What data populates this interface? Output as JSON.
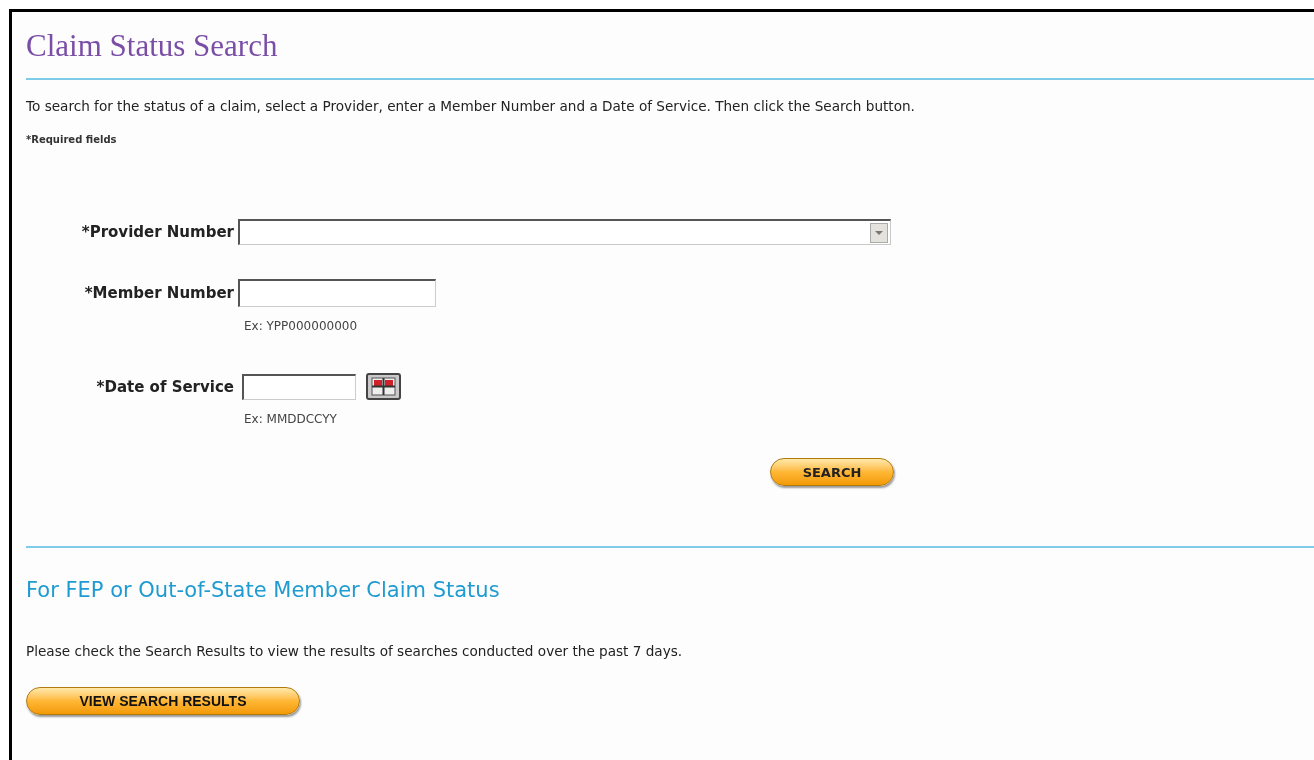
{
  "title": "Claim Status Search",
  "instructions": "To search for the status of a claim, select a Provider, enter a Member Number and a Date of Service. Then click the Search button.",
  "required_note": "*Required fields",
  "fields": [
    {
      "kind": "select",
      "label": "*Provider Number"
    },
    {
      "kind": "text",
      "label": "*Member Number",
      "hint": "Ex: YPP000000000"
    },
    {
      "kind": "date",
      "label": "*Date of Service",
      "hint": "Ex: MMDDCCYY"
    }
  ],
  "search_button": "SEARCH",
  "fep_section": {
    "heading": "For FEP or Out-of-State Member Claim Status",
    "text": "Please check the Search Results to view the results of searches conducted over the past 7 days.",
    "button": "VIEW SEARCH RESULTS"
  }
}
